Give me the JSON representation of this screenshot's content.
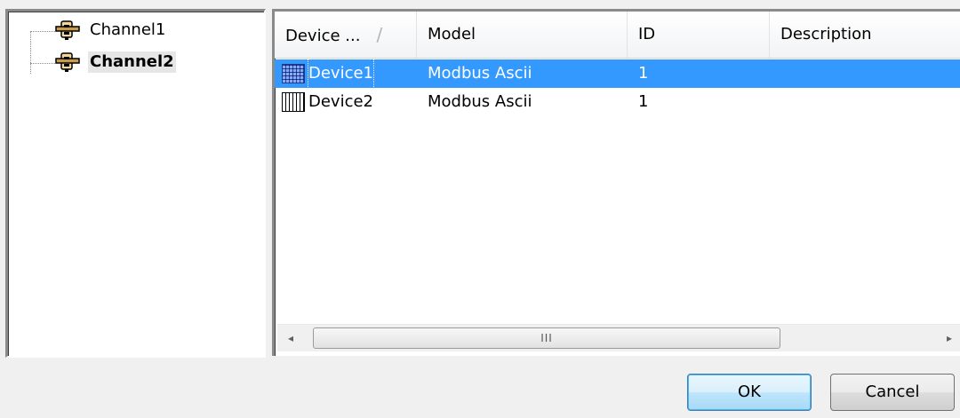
{
  "tree": {
    "nodes": [
      {
        "label": "Channel1",
        "icon": "channel-plug-icon",
        "selected": false
      },
      {
        "label": "Channel2",
        "icon": "channel-plug-icon",
        "selected": true
      }
    ]
  },
  "list": {
    "columns": [
      {
        "label": "Device ...",
        "sort_glyph": "/"
      },
      {
        "label": "Model"
      },
      {
        "label": "ID"
      },
      {
        "label": "Description"
      }
    ],
    "rows": [
      {
        "name": "Device1",
        "model": "Modbus Ascii",
        "id": "1",
        "description": "",
        "selected": true
      },
      {
        "name": "Device2",
        "model": "Modbus Ascii",
        "id": "1",
        "description": "",
        "selected": false
      }
    ],
    "scrollbar": {
      "left_arrow": "◂",
      "thumb_grip": "III",
      "right_arrow": "▸"
    }
  },
  "buttons": {
    "ok": "OK",
    "cancel": "Cancel"
  },
  "colors": {
    "selection": "#3399ff",
    "window_bg": "#f0f0f0"
  }
}
